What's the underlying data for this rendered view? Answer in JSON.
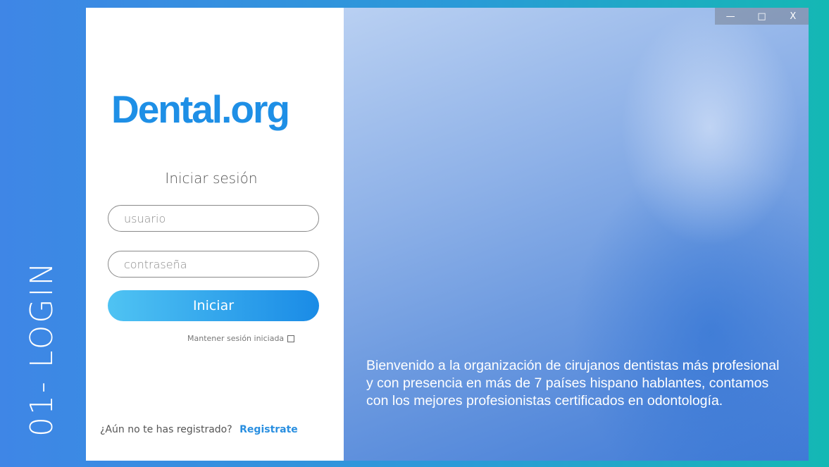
{
  "side_label": "01- LOGIN",
  "login": {
    "logo": "Dental.org",
    "title": "Iniciar sesión",
    "username_placeholder": "usuario",
    "password_placeholder": "contraseña",
    "submit_label": "Iniciar",
    "keep_session_label": "Mantener sesión iniciada",
    "register_prompt": "¿Aún no te has registrado?",
    "register_link": "Registrate"
  },
  "hero": {
    "welcome_text": "Bienvenido a la organización de cirujanos dentistas más profesional y con presencia en más de 7 países hispano hablantes,  contamos con los mejores profesionistas certificados en odontología."
  },
  "window_controls": {
    "minimize_icon": "—",
    "maximize_icon": "□",
    "close_icon": "X"
  },
  "colors": {
    "brand_blue": "#1e8fe6",
    "button_gradient_start": "#4fc3f3",
    "button_gradient_end": "#1a8be6"
  }
}
